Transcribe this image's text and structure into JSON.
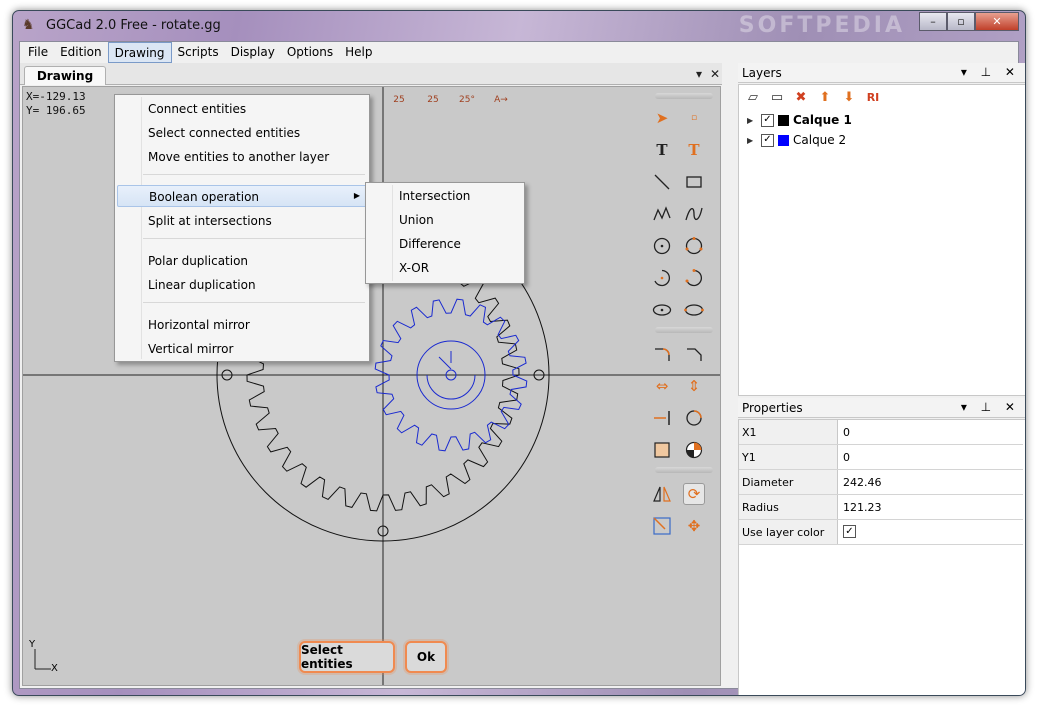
{
  "window": {
    "title": "GGCad 2.0 Free - rotate.gg",
    "watermark": "SOFTPEDIA",
    "controls": {
      "minimize": "–",
      "maximize": "▫",
      "close": "✕"
    }
  },
  "menubar": [
    "File",
    "Edition",
    "Drawing",
    "Scripts",
    "Display",
    "Options",
    "Help"
  ],
  "doc_tab": {
    "label": "Drawing",
    "pin": "▾",
    "close": "✕"
  },
  "canvas": {
    "coords": "X=-129.13\nY= 196.65",
    "top_icons": [
      "25",
      "25",
      "25°",
      "A→"
    ],
    "axis_x": "X",
    "axis_y": "Y",
    "select_button": "Select entities",
    "ok_button": "Ok",
    "canvas_watermark": "SOFTPEDIA",
    "colors": {
      "background": "#c9c9c9",
      "gear_outer": "#111111",
      "gear_inner": "#1a2ad0",
      "accent": "#f08a50"
    }
  },
  "drawing_menu": {
    "items": [
      {
        "label": "Connect entities"
      },
      {
        "label": "Select connected entities"
      },
      {
        "label": "Move entities to another layer"
      },
      {
        "label": "Boolean operation",
        "submenu": true
      },
      {
        "label": "Split at intersections"
      },
      {
        "label": "Polar duplication"
      },
      {
        "label": "Linear duplication"
      },
      {
        "label": "Horizontal mirror"
      },
      {
        "label": "Vertical mirror"
      }
    ]
  },
  "boolean_submenu": {
    "items": [
      "Intersection",
      "Union",
      "Difference",
      "X-OR"
    ]
  },
  "layers_panel": {
    "title": "Layers",
    "header_controls": "▾ ⊥ ✕",
    "tools": [
      "new-layer-icon",
      "duplicate-layer-icon",
      "delete-layer-icon",
      "move-up-icon",
      "move-down-icon",
      "rename-icon"
    ],
    "tool_glyphs": [
      "▱",
      "▭",
      "✖",
      "⬆",
      "⬇",
      "RI"
    ],
    "layers": [
      {
        "name": "Calque 1",
        "checked": true,
        "color": "#000000",
        "bold": true,
        "check_glyph": "✓"
      },
      {
        "name": "Calque 2",
        "checked": true,
        "color": "#0000ff",
        "bold": false,
        "check_glyph": "✓"
      }
    ]
  },
  "properties_panel": {
    "title": "Properties",
    "header_controls": "▾ ⊥ ✕",
    "rows": [
      {
        "key": "X1",
        "value": "0"
      },
      {
        "key": "Y1",
        "value": "0"
      },
      {
        "key": "Diameter",
        "value": "242.46"
      },
      {
        "key": "Radius",
        "value": "121.23"
      },
      {
        "key": "Use layer color",
        "value": "✓"
      }
    ]
  }
}
